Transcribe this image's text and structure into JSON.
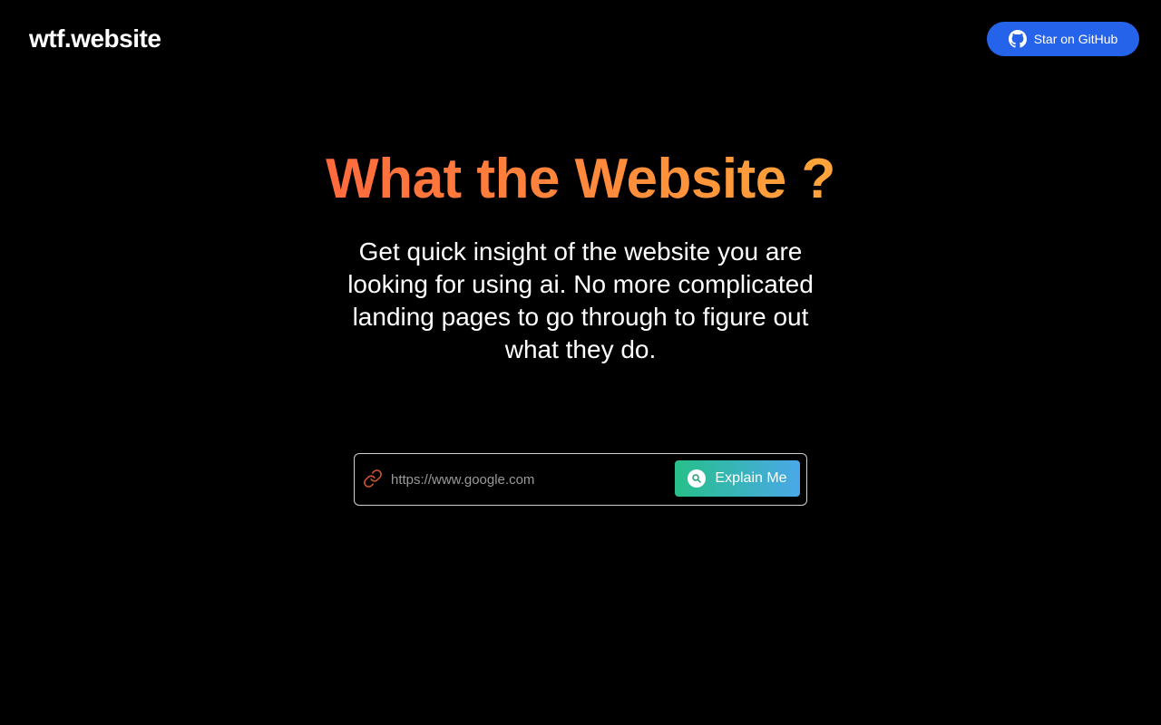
{
  "header": {
    "logo_text": "wtf.website",
    "github_button_label": "Star on GitHub",
    "github_icon": "github-icon"
  },
  "hero": {
    "title": "What the Website ?",
    "subtitle": "Get quick insight of the website you are looking for using ai. No more complicated landing pages to go through to figure out what they do."
  },
  "search": {
    "link_icon": "link-icon",
    "placeholder": "https://www.google.com",
    "value": "",
    "button_label": "Explain Me",
    "button_icon": "search-icon"
  },
  "colors": {
    "background": "#000000",
    "github_button": "#2563eb",
    "title_gradient_start": "#ff6a3d",
    "title_gradient_end": "#ffa53a",
    "button_gradient_start": "#27c08a",
    "button_gradient_end": "#4aa8e8",
    "link_icon": "#c2552e"
  }
}
